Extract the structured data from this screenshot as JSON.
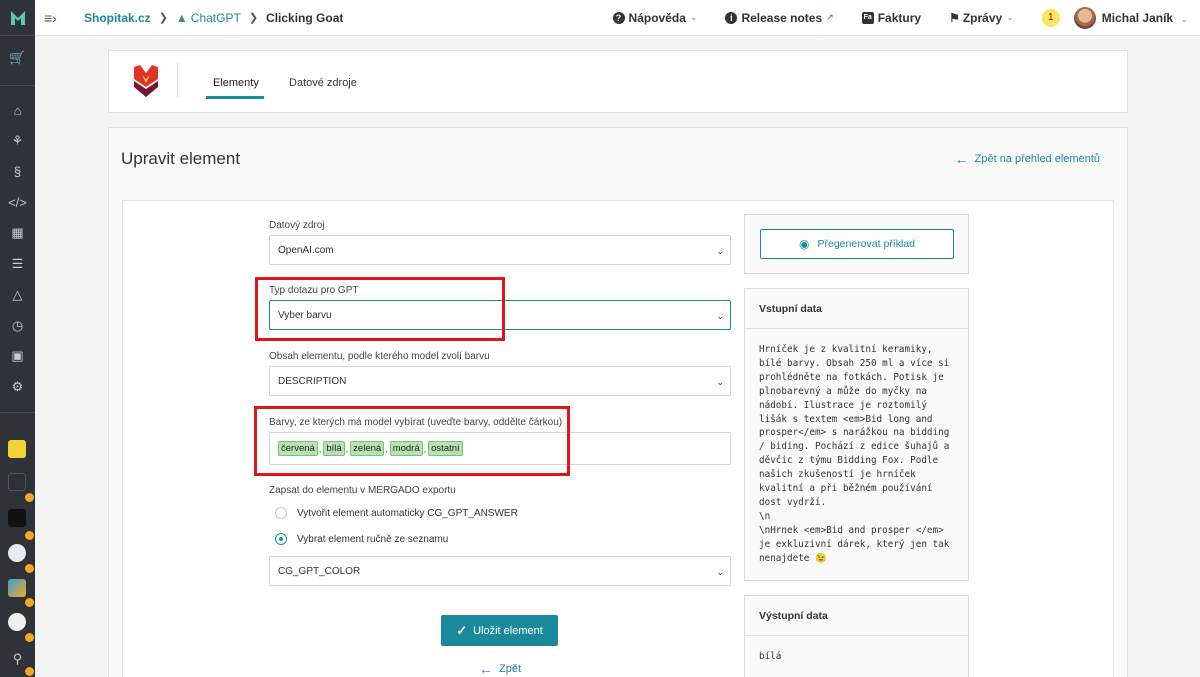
{
  "breadcrumb": {
    "shop": "Shopitak.cz",
    "channel": "ChatGPT",
    "current": "Clicking Goat"
  },
  "topbar": {
    "help": "Nápověda",
    "release_notes": "Release notes",
    "invoices": "Faktury",
    "messages": "Zprávy",
    "notifications": "1",
    "user": "Michal Janík"
  },
  "tabs": {
    "elements": "Elementy",
    "data_sources": "Datové zdroje"
  },
  "page": {
    "title": "Upravit element",
    "back_to_list": "Zpět na přehled elementů"
  },
  "form": {
    "data_source_label": "Datový zdroj",
    "data_source_value": "OpenAI.com",
    "query_type_label": "Typ dotazu pro GPT",
    "query_type_value": "Vyber barvu",
    "content_label": "Obsah elementu, podle kterého model zvolí barvu",
    "content_value": "DESCRIPTION",
    "colors_label": "Barvy, ze kterých má model vybírat (uveďte barvy, oddělte čárkou)",
    "colors": [
      "červená",
      "bílá",
      "zelená",
      "modrá",
      "ostatní"
    ],
    "write_label": "Zapsat do elementu v MERGADO exportu",
    "radio_auto": "Vytvořit element automaticky CG_GPT_ANSWER",
    "radio_manual": "Vybrat element ručně ze seznamu",
    "element_value": "CG_GPT_COLOR",
    "save": "Uložit element",
    "back": "Zpět"
  },
  "side": {
    "regenerate": "Přegenerovat příklad",
    "input_title": "Vstupní data",
    "input_text": "Hrníček je z kvalitní keramiky, bílé barvy. Obsah 250 ml a více si prohlédněte na fotkách. Potisk je plnobarevný a může do myčky na nádobí. Ilustrace je roztomilý lišák s textem <em>Bid long and prosper</em> s narážkou na bidding / biding. Pochází z edice šuhajů a děvčic z týmu Bidding Fox. Podle našich zkušeností je hrníček kvalitní a při běžném používání dost vydrží.\n\\n\n\\nHrnek <em>Bid and prosper </em> je exkluzivní dárek, který jen tak nenajdete 😉",
    "output_title": "Výstupní data",
    "output_text": "bílá"
  },
  "colors": {
    "accent": "#1a8a9a",
    "highlight": "#e0141c",
    "tag_bg": "#b7e3b3"
  }
}
